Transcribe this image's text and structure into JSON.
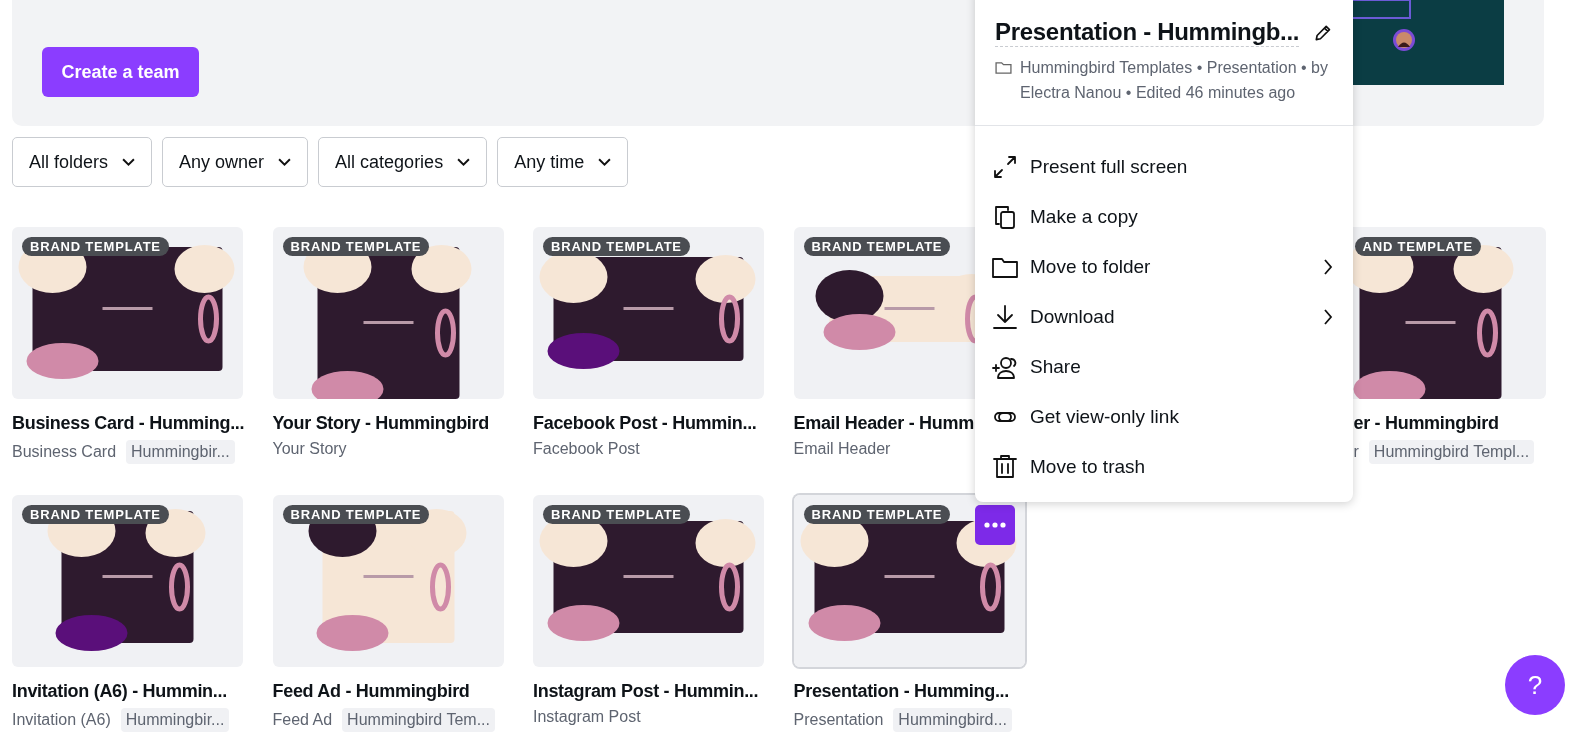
{
  "banner": {
    "button": "Create a team"
  },
  "filters": [
    "All folders",
    "Any owner",
    "All categories",
    "Any time"
  ],
  "cards": [
    {
      "badge": "BRAND TEMPLATE",
      "title": "Business Card - Humming...",
      "type": "Business Card",
      "chip": "Hummingbir...",
      "hovered": false
    },
    {
      "badge": "BRAND TEMPLATE",
      "title": "Your Story - Hummingbird",
      "type": "Your Story",
      "hovered": false
    },
    {
      "badge": "BRAND TEMPLATE",
      "title": "Facebook Post - Hummin...",
      "type": "Facebook Post",
      "hovered": false
    },
    {
      "badge": "BRAND TEMPLATE",
      "title": "Email Header - Humm",
      "type": "Email Header",
      "hovered": false
    },
    {
      "badge": "AND TEMPLATE",
      "title": "er - Hummingbird",
      "type": "r",
      "chip": "Hummingbird Templ...",
      "hovered": false
    },
    {
      "badge": "BRAND TEMPLATE",
      "title": "Invitation (A6) - Hummin...",
      "type": "Invitation (A6)",
      "chip": "Hummingbir...",
      "hovered": false
    },
    {
      "badge": "BRAND TEMPLATE",
      "title": "Feed Ad - Hummingbird",
      "type": "Feed Ad",
      "chip": "Hummingbird Tem...",
      "hovered": false
    },
    {
      "badge": "BRAND TEMPLATE",
      "title": "Instagram Post - Hummin...",
      "type": "Instagram Post",
      "hovered": false
    },
    {
      "badge": "BRAND TEMPLATE",
      "title": "Presentation - Humming...",
      "type": "Presentation",
      "chip": "Hummingbird...",
      "hovered": true
    }
  ],
  "menu": {
    "title": "Presentation - Hummingb...",
    "meta": "Hummingbird Templates • Presentation • by Electra Nanou • Edited 46 minutes ago",
    "items": [
      {
        "kind": "fullscreen",
        "label": "Present full screen",
        "submenu": false
      },
      {
        "kind": "copy",
        "label": "Make a copy",
        "submenu": false
      },
      {
        "kind": "folder",
        "label": "Move to folder",
        "submenu": true
      },
      {
        "kind": "download",
        "label": "Download",
        "submenu": true
      },
      {
        "kind": "share",
        "label": "Share",
        "submenu": false
      },
      {
        "kind": "link",
        "label": "Get view-only link",
        "submenu": false
      },
      {
        "kind": "trash",
        "label": "Move to trash",
        "submenu": false
      }
    ]
  },
  "help": "?"
}
